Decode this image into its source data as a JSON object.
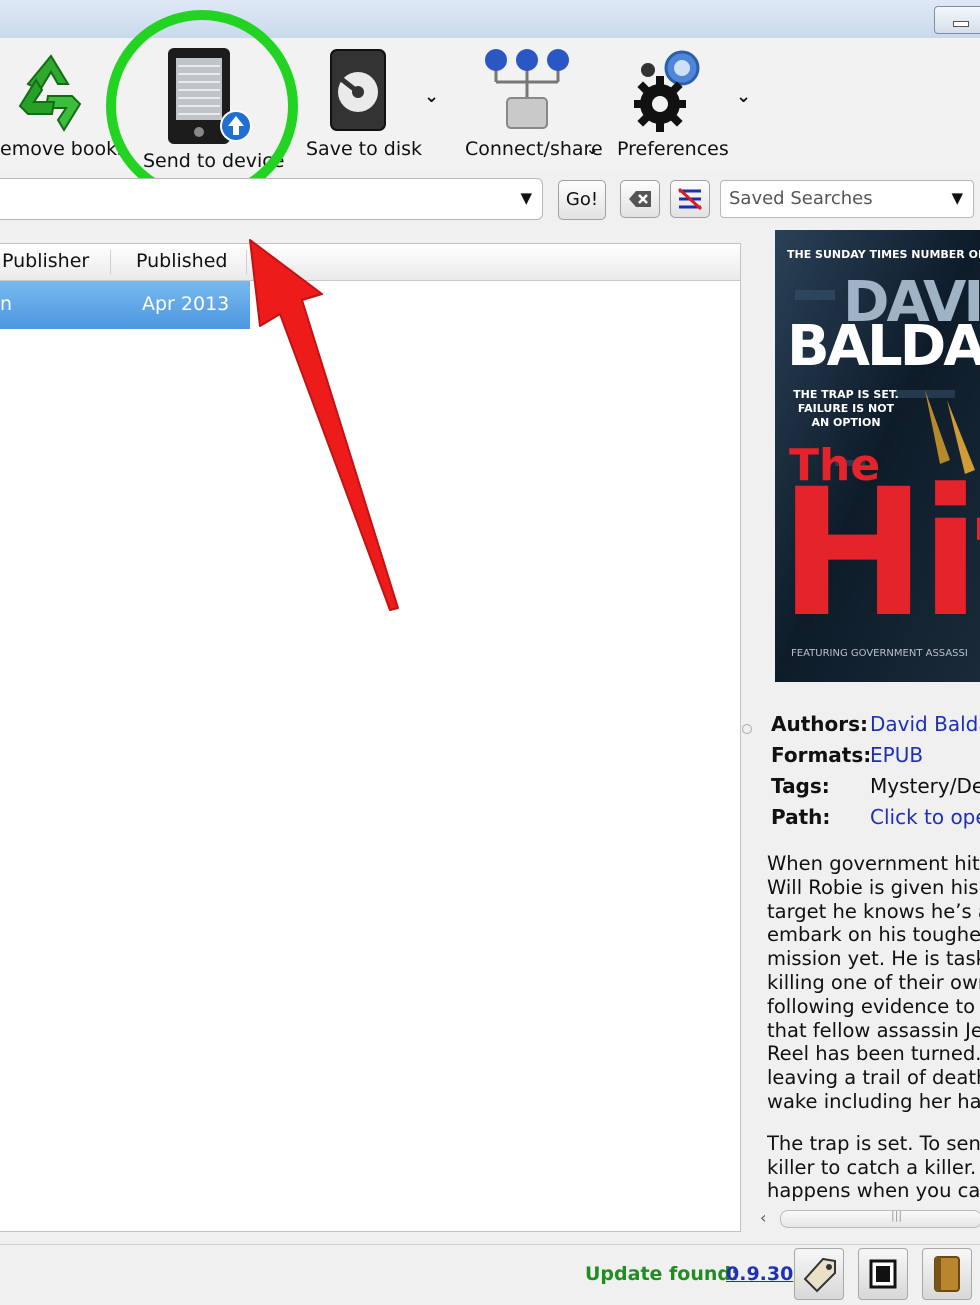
{
  "toolbar": {
    "remove_label": "emove books",
    "send_label": "Send to device",
    "save_label": "Save to disk",
    "connect_label": "Connect/share",
    "prefs_label": "Preferences"
  },
  "search": {
    "go_label": "Go!",
    "saved_searches_placeholder": "Saved Searches"
  },
  "book_list": {
    "columns": [
      "Publisher",
      "Published"
    ],
    "rows": [
      {
        "publisher": "n",
        "published": "Apr 2013"
      }
    ]
  },
  "details": {
    "cover": {
      "tagline": "THE SUNDAY TIMES NUMBER ONE",
      "author_line1": "DAVI",
      "author_line2": "BALDAC",
      "blurb": "THE TRAP IS SET. FAILURE IS NOT AN OPTION",
      "title_word1": "The",
      "title_word2": "Hit",
      "footer": "FEATURING GOVERNMENT ASSASSI"
    },
    "authors_label": "Authors:",
    "authors_value": "David Baldac",
    "formats_label": "Formats:",
    "formats_value": "EPUB",
    "tags_label": "Tags:",
    "tags_value": "Mystery/Det",
    "path_label": "Path:",
    "path_value": "Click to ope",
    "description": [
      "When government hit",
      "Will Robie is given his n",
      "target he knows he’s a",
      "embark on his toughes",
      "mission yet. He is taske",
      "killing one of their own,",
      "following evidence to s",
      "that fellow assassin Jes",
      "Reel has been turned.",
      "leaving a trail of death i",
      "wake including her han"
    ],
    "description2": [
      "The trap is set. To sen",
      "killer to catch a killer. B",
      "happens when you can"
    ]
  },
  "status": {
    "update_label": "Update found:",
    "update_version": "0.9.30"
  },
  "colors": {
    "highlight_ring": "#22d322",
    "arrow": "#ee1b1b",
    "selection": "#4c97e0",
    "link": "#1f2fb8",
    "update_green": "#1f8d1f"
  }
}
